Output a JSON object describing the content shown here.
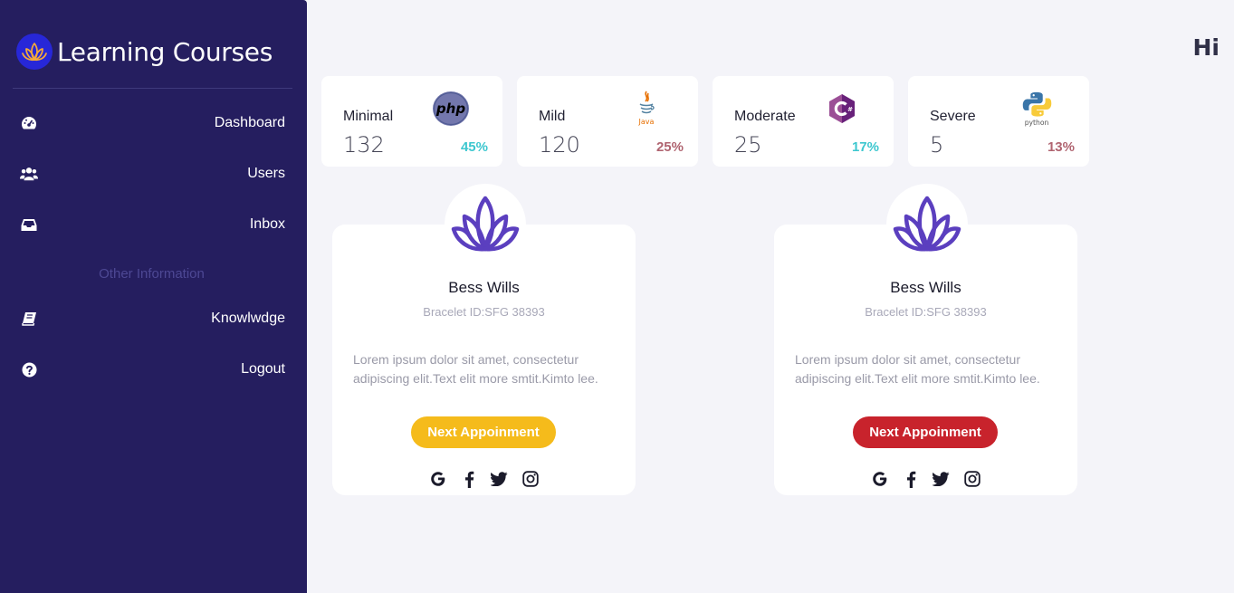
{
  "app": {
    "title": "Learning Courses",
    "greeting": "Hi"
  },
  "sidebar": {
    "items": [
      {
        "label": "Dashboard",
        "icon": "dashboard-gauge-icon"
      },
      {
        "label": "Users",
        "icon": "users-icon"
      },
      {
        "label": "Inbox",
        "icon": "inbox-icon"
      }
    ],
    "section_title": "Other Information",
    "items2": [
      {
        "label": "Knowlwdge",
        "icon": "book-icon"
      },
      {
        "label": "Logout",
        "icon": "question-circle-icon"
      }
    ]
  },
  "stats": [
    {
      "label": "Minimal",
      "value": "132",
      "percent": "45%",
      "percent_color": "#3dc7cf",
      "logo": "php-logo"
    },
    {
      "label": "Mild",
      "value": "120",
      "percent": "25%",
      "percent_color": "#b06470",
      "logo": "java-logo"
    },
    {
      "label": "Moderate",
      "value": "25",
      "percent": "17%",
      "percent_color": "#3dc7cf",
      "logo": "csharp-logo"
    },
    {
      "label": "Severe",
      "value": "5",
      "percent": "13%",
      "percent_color": "#b06470",
      "logo": "python-logo"
    }
  ],
  "profiles": [
    {
      "name": "Bess Wills",
      "bracelet": "Bracelet ID:SFG 38393",
      "description": "Lorem ipsum dolor sit amet, consectetur adipiscing elit.Text elit more smtit.Kimto lee.",
      "button_label": "Next Appoinment",
      "button_color": "#f5bb1b",
      "social": [
        "google-icon",
        "facebook-icon",
        "twitter-icon",
        "instagram-icon"
      ]
    },
    {
      "name": "Bess Wills",
      "bracelet": "Bracelet ID:SFG 38393",
      "description": "Lorem ipsum dolor sit amet, consectetur adipiscing elit.Text elit more smtit.Kimto lee.",
      "button_label": "Next Appoinment",
      "button_color": "#c8232c",
      "social": [
        "google-icon",
        "facebook-icon",
        "twitter-icon",
        "instagram-icon"
      ]
    }
  ],
  "colors": {
    "sidebar_bg": "#251e5f",
    "page_bg": "#f4f4f9",
    "lotus_purple": "#5b3fbf",
    "brand_blue": "#2727d8"
  }
}
